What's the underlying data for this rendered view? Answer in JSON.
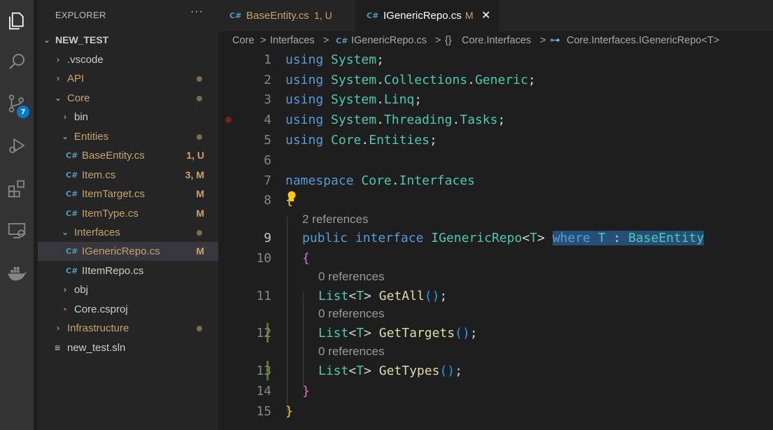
{
  "sidebar": {
    "title": "EXPLORER",
    "more": "···",
    "tree": [
      {
        "label": "NEW_TEST",
        "chev": "⌄"
      },
      {
        "label": ".vscode",
        "chev": "›"
      },
      {
        "label": "API",
        "chev": "›"
      },
      {
        "label": "Core",
        "chev": "⌄"
      },
      {
        "label": "bin",
        "chev": "›"
      },
      {
        "label": "Entities",
        "chev": "⌄"
      },
      {
        "label": "BaseEntity.cs",
        "icon": "C#",
        "status": "1, U"
      },
      {
        "label": "Item.cs",
        "icon": "C#",
        "status": "3, M"
      },
      {
        "label": "ItemTarget.cs",
        "icon": "C#",
        "status": "M"
      },
      {
        "label": "ItemType.cs",
        "icon": "C#",
        "status": "M"
      },
      {
        "label": "Interfaces",
        "chev": "⌄"
      },
      {
        "label": "IGenericRepo.cs",
        "icon": "C#",
        "status": "M"
      },
      {
        "label": "IItemRepo.cs",
        "icon": "C#"
      },
      {
        "label": "obj",
        "chev": "›"
      },
      {
        "label": "Core.csproj",
        "icon": "rss"
      },
      {
        "label": "Infrastructure",
        "chev": "›"
      },
      {
        "label": "new_test.sln",
        "icon": "lines"
      }
    ]
  },
  "activity": {
    "icons": [
      "explorer-icon",
      "search-icon",
      "source-control-icon",
      "run-debug-icon",
      "extensions-icon",
      "remote-explorer-icon",
      "docker-icon"
    ],
    "scm_badge": "7"
  },
  "tabs": [
    {
      "icon": "C#",
      "label": "BaseEntity.cs",
      "status": "1, U"
    },
    {
      "icon": "C#",
      "label": "IGenericRepo.cs",
      "status": "M",
      "close": "✕"
    }
  ],
  "breadcrumb": [
    "Core",
    ">",
    "Interfaces",
    ">",
    "C#",
    "IGenericRepo.cs",
    ">",
    "{}",
    "Core.Interfaces",
    ">",
    "⊶",
    "Core.Interfaces.IGenericRepo<T>"
  ],
  "editor": {
    "line_numbers": [
      "1",
      "2",
      "3",
      "4",
      "5",
      "6",
      "7",
      "8",
      "9",
      "10",
      "11",
      "12",
      "13",
      "14",
      "15"
    ],
    "codelens": [
      "2 references",
      "0 references",
      "0 references",
      "0 references"
    ],
    "lines": {
      "l1": [
        "using",
        "System",
        ";"
      ],
      "l2": [
        "using",
        "System",
        ".",
        "Collections",
        ".",
        "Generic",
        ";"
      ],
      "l3": [
        "using",
        "System",
        ".",
        "Linq",
        ";"
      ],
      "l4": [
        "using",
        "System",
        ".",
        "Threading",
        ".",
        "Tasks",
        ";"
      ],
      "l5": [
        "using",
        "Core",
        ".",
        "Entities",
        ";"
      ],
      "l7": [
        "namespace",
        "Core",
        ".",
        "Interfaces"
      ],
      "l8": [
        "{"
      ],
      "l9": [
        "public",
        "interface",
        "IGenericRepo",
        "<",
        "T",
        ">",
        "where",
        "T",
        ":",
        "BaseEntity"
      ],
      "l10": [
        "{"
      ],
      "l11": [
        "List",
        "<",
        "T",
        ">",
        "GetAll",
        "(",
        ")",
        ";"
      ],
      "l12": [
        "List",
        "<",
        "T",
        ">",
        "GetTargets",
        "(",
        ")",
        ";"
      ],
      "l13": [
        "List",
        "<",
        "T",
        ">",
        "GetTypes",
        "(",
        ")",
        ";"
      ],
      "l14": [
        "}"
      ],
      "l15": [
        "}"
      ]
    }
  },
  "colors": {
    "keyword": "#569cd6",
    "type": "#4ec9b0",
    "function": "#dcdcaa",
    "modified": "#c6a46b",
    "untracked": "#73c991",
    "accent": "#007acc"
  }
}
